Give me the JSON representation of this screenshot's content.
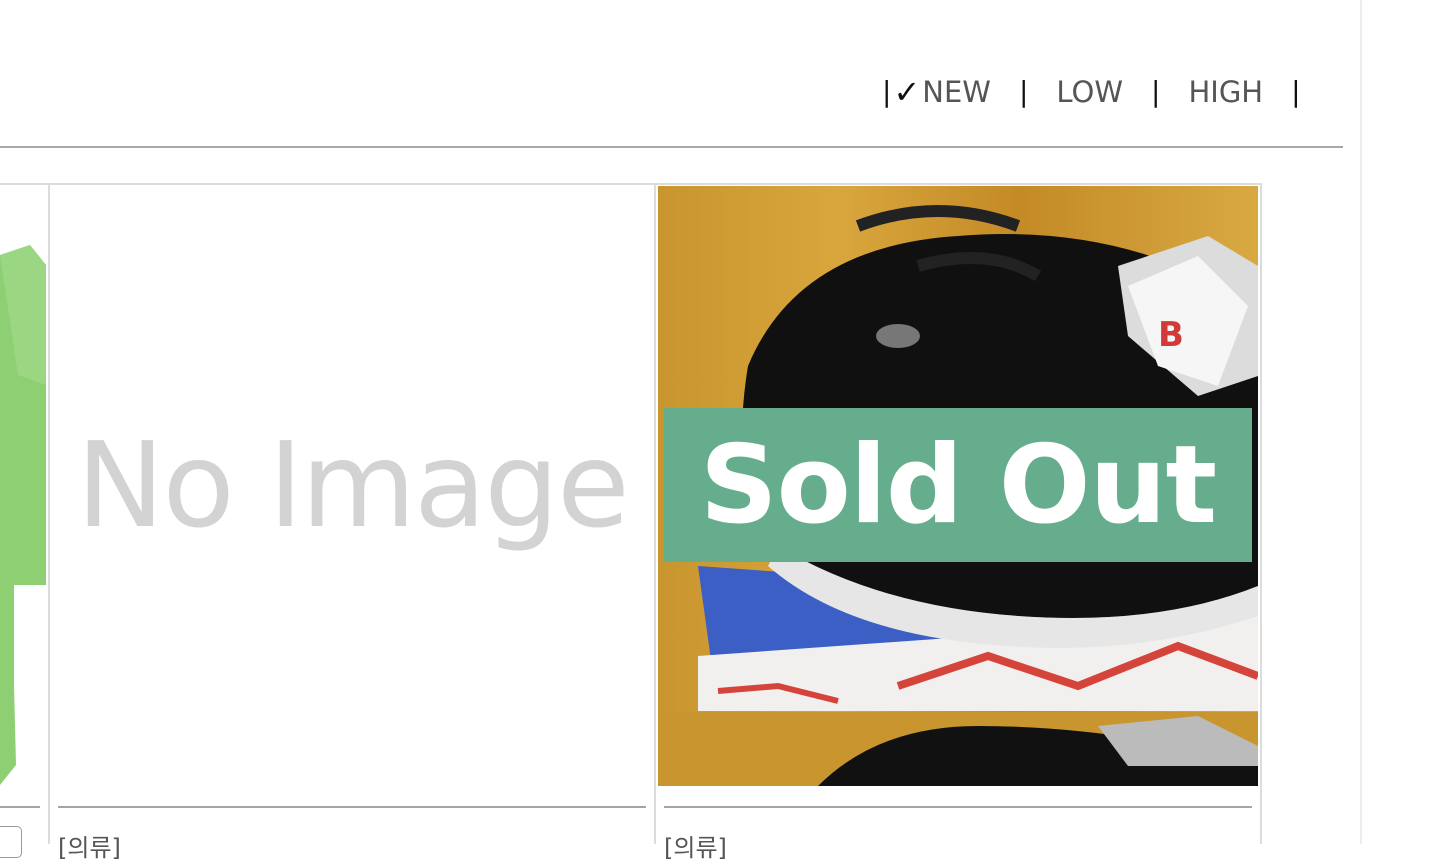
{
  "sort": {
    "options": [
      {
        "label": "NEW",
        "selected": true
      },
      {
        "label": "LOW",
        "selected": false
      },
      {
        "label": "HIGH",
        "selected": false
      }
    ],
    "separator": "|",
    "check": "✓"
  },
  "products": [
    {
      "image": "green-tshirt",
      "name": ""
    },
    {
      "image": "no-image",
      "placeholder": "No Image",
      "name": "[의류]"
    },
    {
      "image": "sneakers",
      "badge": "Sold Out",
      "name": "[의류]"
    }
  ],
  "colors": {
    "sold_out_badge": "#66ad8d",
    "tshirt_green": "#8fcf73"
  }
}
